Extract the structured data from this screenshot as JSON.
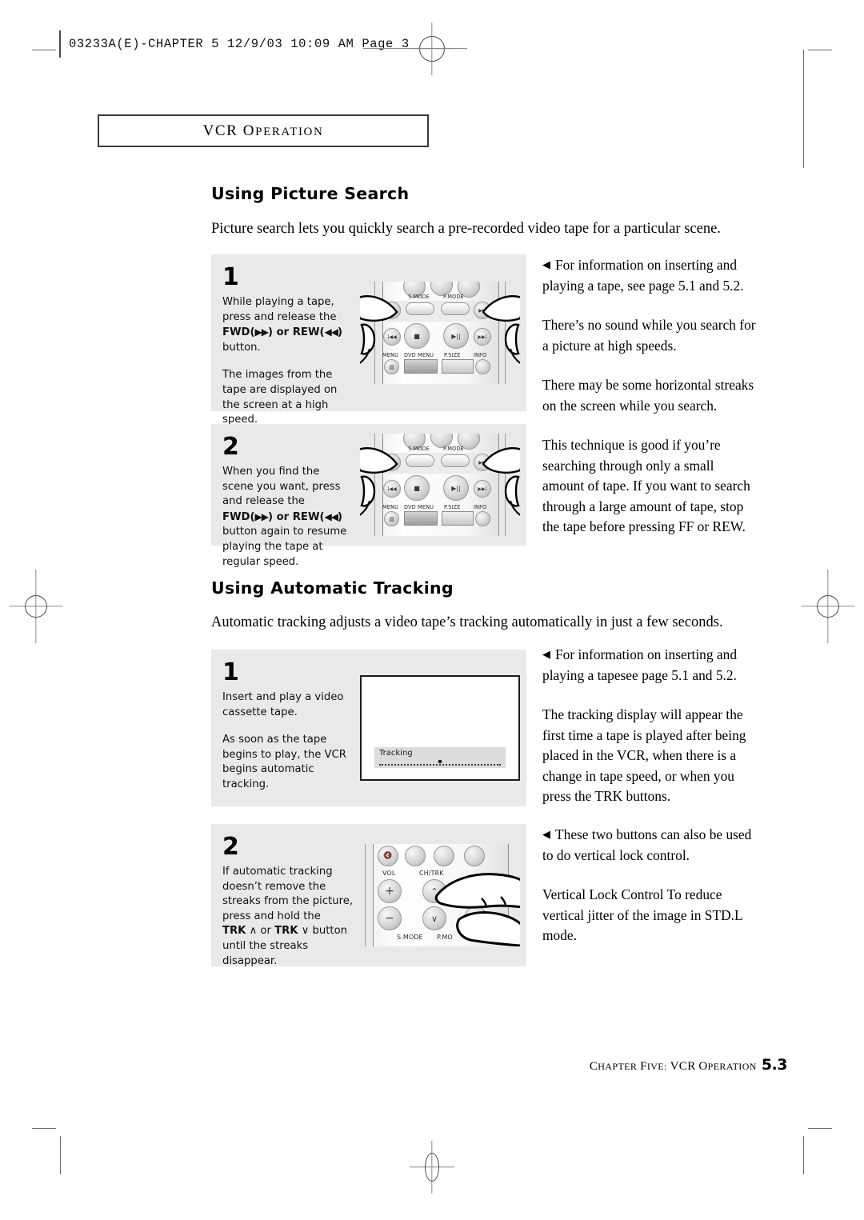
{
  "slug": {
    "text": "03233A(E)-CHAPTER 5   12/9/03  10:09 AM   Page 3"
  },
  "chapter_box": {
    "title_major": "VCR",
    "title_minor": "OPERATION"
  },
  "sections": [
    {
      "heading": "Using Picture Search",
      "intro": "Picture search lets you quickly search a pre-recorded video tape for a particular scene.",
      "steps": [
        {
          "number": "1",
          "paragraph_1_a": "While playing a tape, press and release the ",
          "bold_1": "FWD(",
          "glyph_1": "▶▶",
          "bold_1_end": ") or ",
          "bold_2": "REW(",
          "glyph_2": "◀◀",
          "bold_2_end": ")",
          "paragraph_1_b": " button.",
          "paragraph_2": "The images from the tape are displayed on the screen at a high speed.",
          "art": "remote-transport"
        },
        {
          "number": "2",
          "paragraph_1_a": "When you find the scene you want, press and release the ",
          "bold_1": "FWD(",
          "glyph_1": "▶▶",
          "bold_1_end": ") or ",
          "bold_2": "REW(",
          "glyph_2": "◀◀",
          "bold_2_end": ")",
          "paragraph_1_b": " button again to resume playing the tape at regular speed.",
          "paragraph_2": "",
          "art": "remote-transport"
        }
      ],
      "notes": [
        {
          "has_arrow": true,
          "arrow": "◀",
          "text": "For information on inserting and playing a tape, see page 5.1 and 5.2."
        },
        {
          "has_arrow": false,
          "arrow": "",
          "text": "There’s no sound while you search for a picture at high speeds."
        },
        {
          "has_arrow": false,
          "arrow": "",
          "text": "There may be some horizontal streaks on the screen while you search."
        },
        {
          "has_arrow": false,
          "arrow": "",
          "text": "This technique is good if you’re searching through only a small amount of tape. If you want to search through a large amount of tape, stop the tape before pressing FF or REW."
        }
      ]
    },
    {
      "heading": "Using Automatic Tracking",
      "intro": "Automatic tracking adjusts a video tape’s tracking automatically in just a few seconds.",
      "steps": [
        {
          "number": "1",
          "paragraph_1_a": "Insert and play a video cassette tape.",
          "paragraph_2": "As soon as the tape begins to play, the VCR begins automatic tracking.",
          "art": "tv-screen"
        },
        {
          "number": "2",
          "paragraph_1_a": "If automatic tracking doesn’t remove the streaks from the picture, press and hold the ",
          "bold_1": "TRK",
          "glyph_1": "∧",
          "bold_1_end": " or ",
          "bold_2": "TRK",
          "glyph_2": "∨",
          "paragraph_1_b": " button until the streaks disappear.",
          "art": "remote-voltrk"
        }
      ],
      "notes": [
        {
          "has_arrow": true,
          "arrow": "◀",
          "text": "For information on inserting and playing a tapesee page 5.1 and 5.2."
        },
        {
          "has_arrow": false,
          "arrow": "",
          "text": "The tracking display will appear the first time a tape is played after being placed in the VCR, when there is a change in tape speed, or when you press the TRK buttons."
        },
        {
          "has_arrow": true,
          "arrow": "◀",
          "text": "These two buttons can also be used to do vertical lock control."
        },
        {
          "has_arrow": false,
          "arrow": "",
          "text": "Vertical Lock Control To reduce vertical jitter of the image in STD.L mode."
        }
      ]
    }
  ],
  "tv_osd": {
    "label": "Tracking"
  },
  "remote_transport": {
    "label_smode": "S.MODE",
    "label_pmode": "P.MODE",
    "label_menu": "MENU",
    "label_dvd_menu": "DVD MENU",
    "label_psize": "P.SIZE",
    "label_info": "INFO",
    "btn_rew": "◀◀",
    "btn_fwd": "▶▶",
    "btn_prev": "|◀◀",
    "btn_next": "▶▶|",
    "btn_stop": "■",
    "btn_play": "▶||"
  },
  "remote_voltrk": {
    "label_vol": "VOL",
    "label_chtrk": "CH/TRK",
    "label_smode": "S.MODE",
    "label_pmode": "P.MO",
    "btn_plus": "+",
    "btn_minus": "−",
    "btn_up": "∨",
    "btn_down": "∨",
    "btn_mute": "🔇"
  },
  "footer": {
    "text_major_1": "C",
    "text_minor_1": "HAPTER",
    "text_major_2": "F",
    "text_minor_2": "IVE",
    "colon": ": ",
    "text_major_3": "VCR",
    "text_major_4": "O",
    "text_minor_4": "PERATION",
    "full_text": "CHAPTER FIVE: VCR OPERATION",
    "page_number": "5.3"
  },
  "colors": {
    "panel_background": "#e9e9e9",
    "page_background": "#ffffff",
    "ink": "#000000",
    "mark_gray": "#8a8a8a"
  }
}
